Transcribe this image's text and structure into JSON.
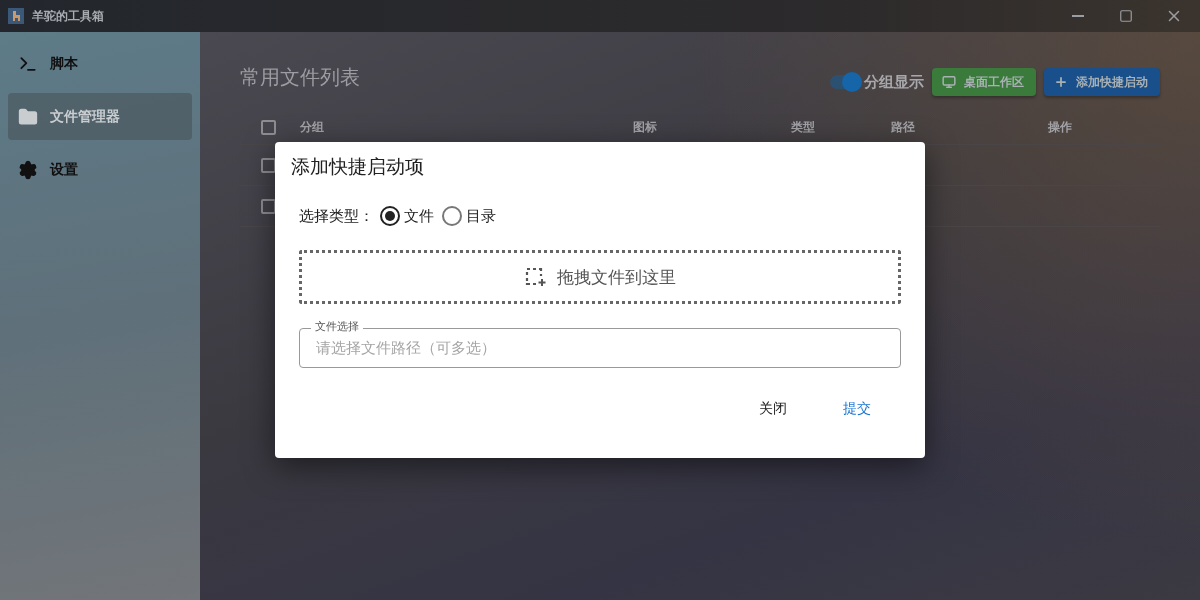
{
  "window": {
    "title": "羊驼的工具箱"
  },
  "sidebar": {
    "items": [
      {
        "label": "脚本",
        "selected": false
      },
      {
        "label": "文件管理器",
        "selected": true
      },
      {
        "label": "设置",
        "selected": false
      }
    ]
  },
  "page": {
    "title": "常用文件列表",
    "group_toggle": {
      "label": "分组显示",
      "on": true
    },
    "buttons": [
      {
        "label": "桌面工作区",
        "kind": "desktop"
      },
      {
        "label": "添加快捷启动",
        "kind": "add"
      }
    ]
  },
  "table": {
    "header_checked": false,
    "columns": [
      "分组",
      "图标",
      "类型",
      "路径",
      "操作"
    ],
    "rows": [
      {
        "checked": false
      },
      {
        "checked": false
      }
    ]
  },
  "dialog": {
    "title": "添加快捷启动项",
    "type_label": "选择类型：",
    "options": [
      {
        "label": "文件",
        "selected": true
      },
      {
        "label": "目录",
        "selected": false
      }
    ],
    "drop_zone": "拖拽文件到这里",
    "file_field": {
      "label": "文件选择",
      "placeholder": "请选择文件路径（可多选）"
    },
    "actions": [
      {
        "label": "关闭",
        "kind": "close"
      },
      {
        "label": "提交",
        "kind": "submit"
      }
    ]
  }
}
